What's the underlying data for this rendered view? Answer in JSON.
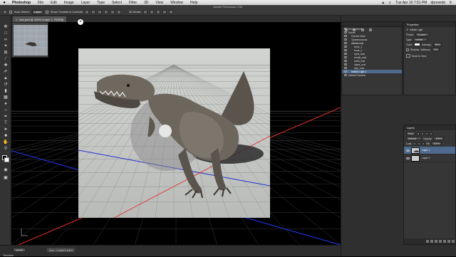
{
  "menubar": {
    "apple": "",
    "app": "Photoshop",
    "items": [
      "File",
      "Edit",
      "Image",
      "Layer",
      "Type",
      "Select",
      "Filter",
      "3D",
      "View",
      "Window",
      "Help"
    ],
    "clock": "Tue Apr 10  7:51 PM",
    "user": "dpresedo"
  },
  "window_title": "Adobe Photoshop CS6",
  "options": {
    "auto_select": "Auto-Select:",
    "auto_select_value": "Layer",
    "show_transform": "Show Transform Controls",
    "mode_label": "3D Mode:"
  },
  "document": {
    "tab": "trex.psd @ 100% (Layer 1, RGB/8)"
  },
  "scene_panel": {
    "items": [
      {
        "label": "Environment",
        "indent": 0,
        "selected": false
      },
      {
        "label": "Scene",
        "indent": 0,
        "selected": false
      },
      {
        "label": "Current View",
        "indent": 1,
        "selected": false
      },
      {
        "label": "Tyrannosaurus",
        "indent": 1,
        "selected": false
      },
      {
        "label": "allMaterials",
        "indent": 1,
        "selected": false
      },
      {
        "label": "bone_1",
        "indent": 2,
        "selected": false
      },
      {
        "label": "bone_2",
        "indent": 2,
        "selected": false
      },
      {
        "label": "eyes_mat",
        "indent": 2,
        "selected": false
      },
      {
        "label": "mouth_mat",
        "indent": 2,
        "selected": false
      },
      {
        "label": "teeth_mat",
        "indent": 2,
        "selected": false
      },
      {
        "label": "claws_mat",
        "indent": 2,
        "selected": false
      },
      {
        "label": "skin_mat",
        "indent": 2,
        "selected": false
      },
      {
        "label": "Infinite Light 1",
        "indent": 1,
        "selected": true
      },
      {
        "label": "Default Camera",
        "indent": 0,
        "selected": false
      }
    ]
  },
  "properties": {
    "tab": "Properties",
    "title": "Infinite Light",
    "preset_label": "Preset:",
    "preset_value": "Custom",
    "type_label": "Type:",
    "type_value": "Infinite",
    "color_label": "Color:",
    "intensity_label": "Intensity:",
    "intensity_value": "90%",
    "shadow_label": "Shadow",
    "softness_label": "Softness:",
    "softness_value": "0%",
    "move_to_view": "Move to View"
  },
  "layers_panel": {
    "tab": "Layers",
    "kind_label": "Kind",
    "blend_mode": "Normal",
    "opacity_label": "Opacity:",
    "opacity_value": "100%",
    "lock_label": "Lock:",
    "fill_label": "Fill:",
    "fill_value": "100%",
    "layers": [
      {
        "name": "Layer 1",
        "active": true
      },
      {
        "name": "Layer 2",
        "active": false
      }
    ]
  },
  "status": {
    "zoom": "100%",
    "doc_size": "Doc: 2.64M/2.64M",
    "timeline": "Timeline"
  },
  "colors": {
    "axis_red": "#e0302c",
    "axis_blue": "#2030d0",
    "selection_blue": "#4f6a8f"
  }
}
